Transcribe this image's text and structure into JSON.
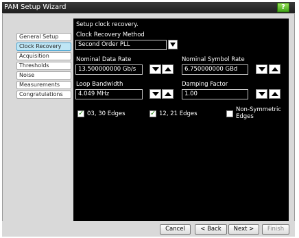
{
  "window": {
    "title": "PAM Setup Wizard",
    "help_label": "?"
  },
  "nav": {
    "items": [
      "General Setup",
      "Clock Recovery",
      "Acquisition",
      "Thresholds",
      "Noise",
      "Measurements",
      "Congratulations"
    ],
    "active_index": 1
  },
  "panel": {
    "heading": "Setup clock recovery.",
    "method_label": "Clock Recovery Method",
    "method_value": "Second Order PLL",
    "nominal_data_rate_label": "Nominal Data Rate",
    "nominal_data_rate_value": "13.500000000 Gb/s",
    "nominal_symbol_rate_label": "Nominal Symbol Rate",
    "nominal_symbol_rate_value": "6.750000000 GBd",
    "loop_bandwidth_label": "Loop Bandwidth",
    "loop_bandwidth_value": "4.049 MHz",
    "damping_factor_label": "Damping Factor",
    "damping_factor_value": "1.00",
    "checkboxes": [
      {
        "label": "03, 30 Edges",
        "checked": true
      },
      {
        "label": "12, 21 Edges",
        "checked": true
      },
      {
        "label_line1": "Non-Symmetric",
        "label_line2": "Edges",
        "checked": false
      }
    ]
  },
  "footer": {
    "cancel": "Cancel",
    "back": "< Back",
    "next": "Next >",
    "finish": "Finish"
  },
  "colors": {
    "panel_bg": "#000000",
    "active_nav": "#bfe6f5",
    "help_green": "#3fa416",
    "check_green": "#2e8b1a"
  }
}
